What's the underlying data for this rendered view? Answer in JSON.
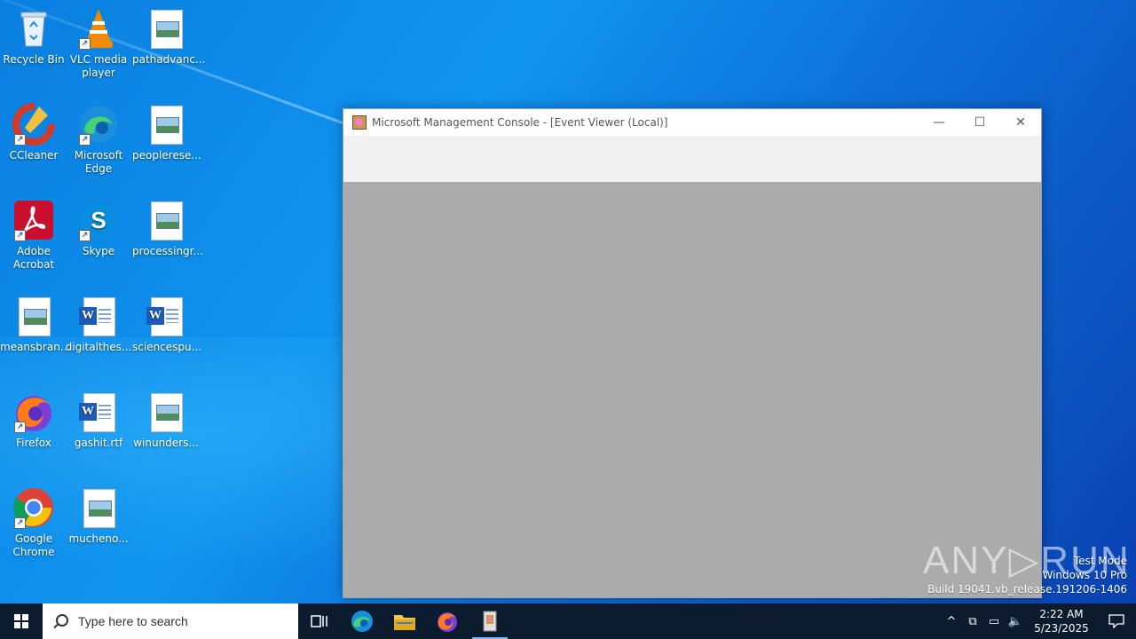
{
  "desktop": {
    "icons": [
      {
        "label": "Recycle Bin",
        "icon": "recycle-bin-icon"
      },
      {
        "label": "VLC media player",
        "icon": "vlc-icon"
      },
      {
        "label": "pathadvanc...",
        "icon": "image-file-icon"
      },
      {
        "label": "CCleaner",
        "icon": "ccleaner-icon"
      },
      {
        "label": "Microsoft Edge",
        "icon": "edge-icon"
      },
      {
        "label": "peoplerese...",
        "icon": "image-file-icon"
      },
      {
        "label": "Adobe Acrobat",
        "icon": "acrobat-icon"
      },
      {
        "label": "Skype",
        "icon": "skype-icon"
      },
      {
        "label": "processingr...",
        "icon": "image-file-icon"
      },
      {
        "label": "meansbran...",
        "icon": "image-file-icon"
      },
      {
        "label": "digitalthes...",
        "icon": "word-file-icon"
      },
      {
        "label": "sciencespu...",
        "icon": "word-file-icon"
      },
      {
        "label": "Firefox",
        "icon": "firefox-icon"
      },
      {
        "label": "gashit.rtf",
        "icon": "word-file-icon"
      },
      {
        "label": "winunders...",
        "icon": "image-file-icon"
      },
      {
        "label": "Google Chrome",
        "icon": "chrome-icon"
      },
      {
        "label": "mucheno...",
        "icon": "image-file-icon"
      }
    ]
  },
  "window": {
    "title": "Microsoft Management Console - [Event Viewer (Local)]",
    "minimize": "—",
    "maximize": "☐",
    "close": "✕"
  },
  "watermark": {
    "brand": "ANY▷RUN",
    "line1": "Test Mode",
    "line2": "Windows 10 Pro",
    "line3": "Build 19041.vb_release.191206-1406"
  },
  "taskbar": {
    "search_placeholder": "Type here to search",
    "time": "2:22 AM",
    "date": "5/23/2025"
  },
  "colors": {
    "taskbar_bg": "#0d1b2e",
    "client_bg": "#ababab",
    "toolbar_bg": "#f0f0f0"
  }
}
